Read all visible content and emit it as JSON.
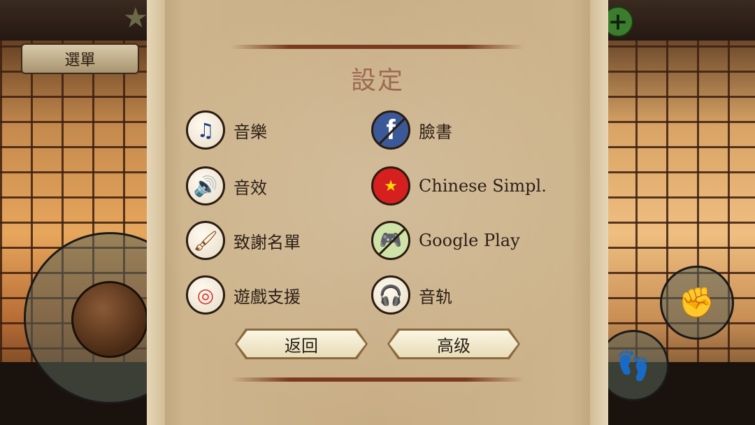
{
  "hud": {
    "menu_label": "選單",
    "star_icon": "shuriken-icon",
    "plus_icon": "plus-icon",
    "punch_icon": "fist-icon",
    "kick_icon": "foot-icon"
  },
  "settings": {
    "title": "設定",
    "items_left": [
      {
        "label": "音樂",
        "icon": "music-note-icon"
      },
      {
        "label": "音效",
        "icon": "speaker-icon"
      },
      {
        "label": "致謝名單",
        "icon": "brush-icon"
      },
      {
        "label": "遊戲支援",
        "icon": "lifebuoy-icon"
      }
    ],
    "items_right": [
      {
        "label": "臉書",
        "icon": "facebook-icon"
      },
      {
        "label": "Chinese Simpl.",
        "icon": "china-flag-icon"
      },
      {
        "label": "Google Play",
        "icon": "google-play-games-icon"
      },
      {
        "label": "音轨",
        "icon": "headphones-icon"
      }
    ],
    "back_label": "返回",
    "advanced_label": "高级"
  },
  "colors": {
    "paper": "#c8ad84",
    "title": "#9c6a52",
    "text": "#2b1f16",
    "accent_rule": "#7a3a22"
  }
}
